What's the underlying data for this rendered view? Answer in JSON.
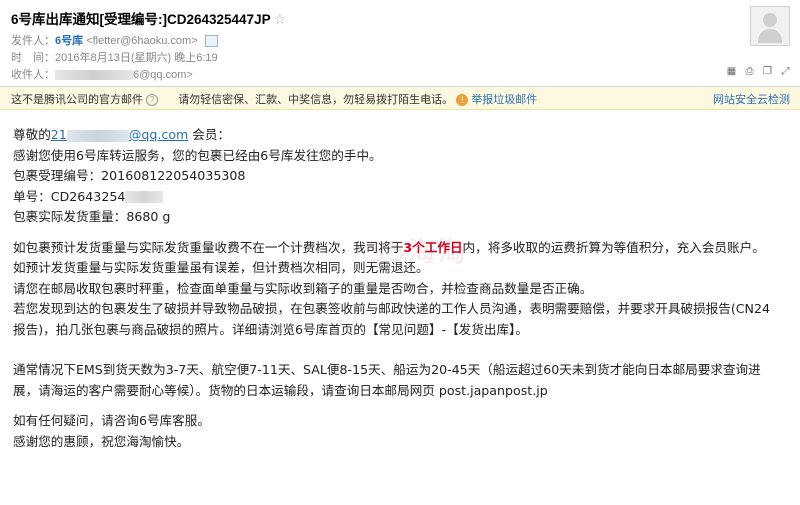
{
  "header": {
    "subject": "6号库出库通知[受理编号:]CD264325447JP",
    "sender_label": "发件人：",
    "sender_name": "6号库",
    "sender_email": "<fletter@6haoku.com>",
    "time_label": "时　间：",
    "time_value": "2016年8月13日(星期六) 晚上6:19",
    "recipient_label": "收件人：",
    "recipient_suffix": "6@qq.com>",
    "star_glyph": "☆"
  },
  "notice": {
    "official_text": "这不是腾讯公司的官方邮件",
    "warning_text": "请勿轻信密保、汇款、中奖信息，勿轻易拨打陌生电话。",
    "report_label": "举报垃圾邮件",
    "security_label": "网站安全云检测"
  },
  "body": {
    "greeting_prefix": "尊敬的",
    "greeting_email_start": "21",
    "greeting_email_end": "@qq.com",
    "greeting_suffix": " 会员：",
    "line_thanks": "感谢您使用6号库转运服务，您的包裹已经由6号库发往您的手中。",
    "line_accept_no": "包裹受理编号：201608122054035308",
    "line_tracking_prefix": "单号：CD2643254",
    "line_weight": "包裹实际发货重量：8680 g",
    "para1_before": "如包裹预计发货重量与实际发货重量收费不在一个计费档次，我司将于",
    "para1_highlight": "3个工作日",
    "para1_after": "内，将多收取的运费折算为等值积分，充入会员账户。",
    "para2": "如预计发货重量与实际发货重量虽有误差，但计费档次相同，则无需退还。",
    "para3": "请您在邮局收取包裹时秤重，检查面单重量与实际收到箱子的重量是否吻合，并检查商品数量是否正确。",
    "para4_line1": "若您发现到达的包裹发生了破损并导致物品破损，在包裹签收前与邮政快递的工作人员沟通，表明需要赔偿，并要求开具破损报告(CN24",
    "para4_line2": "报告)，拍几张包裹与商品破损的照片。详细请浏览6号库首页的【常见问题】-【发货出库】。",
    "para5_line1": "通常情况下EMS到货天数为3-7天、航空便7-11天、SAL便8-15天、船运为20-45天（船运超过60天未到货才能向日本邮局要求查询进",
    "para5_line2": "展，请海运的客户需要耐心等候）。货物的日本运输段，请查询日本邮局网页 post.japanpost.jp",
    "para6": "如有任何疑问，请咨询6号库客服。",
    "para7": "感谢您的惠顾，祝您海淘愉快。"
  },
  "watermark": "55海淘",
  "colors": {
    "link": "#2a6fb5",
    "highlight": "#d0021b",
    "notice_bg": "#fdf8e0"
  }
}
